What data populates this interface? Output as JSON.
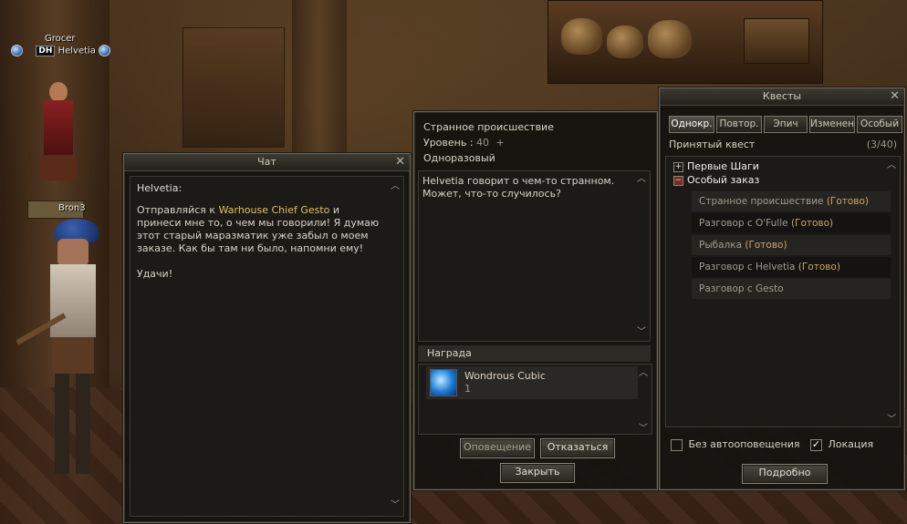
{
  "nameplates": {
    "grocer": "Grocer",
    "player_clan": "DH",
    "player_name": "Helvetia",
    "npc_bron": "Bron3"
  },
  "chat": {
    "title": "Чат",
    "speaker": "Helvetia:",
    "line1_pre": "Отправляйся к ",
    "line1_npc": "Warhouse Chief Gesto",
    "line1_post": " и принеси мне то, о чем мы говорили! Я думаю этот старый маразматик уже забыл о моем заказе. Как бы там ни было, напомни ему!",
    "line2": "Удачи!"
  },
  "quest_detail": {
    "name": "Странное происшествие",
    "level_label": "Уровень :",
    "level_value": "40",
    "level_plus": "+",
    "type": "Одноразовый",
    "description": "Helvetia говорит о чем-то странном. Может, что-то случилось?",
    "reward_header": "Награда",
    "reward_item": "Wondrous Cubic",
    "reward_qty": "1",
    "btn_notify": "Оповещение",
    "btn_decline": "Отказаться",
    "btn_close": "Закрыть"
  },
  "quests": {
    "title": "Квесты",
    "tabs": [
      "Однокр.",
      "Повтор.",
      "Эпич",
      "Изменен",
      "Особый"
    ],
    "accepted_label": "Принятый квест",
    "accepted_count": "(3/40)",
    "groups": [
      "Первые Шаги",
      "Особый заказ"
    ],
    "items": [
      {
        "name": "Странное происшествие",
        "status": "(Готово)"
      },
      {
        "name": "Разговор с O'Fulle",
        "status": "(Готово)"
      },
      {
        "name": "Рыбалка",
        "status": "(Готово)"
      },
      {
        "name": "Разговор с Helvetia",
        "status": "(Готово)"
      },
      {
        "name": "Разговор с Gesto",
        "status": ""
      }
    ],
    "opt_no_notify": "Без автооповещения",
    "opt_location": "Локация",
    "btn_details": "Подробно"
  },
  "icons": {
    "close": "close-icon",
    "scroll_up": "scroll-up-icon",
    "scroll_down": "scroll-down-icon",
    "reward": "cube-icon"
  },
  "colors": {
    "npc_highlight": "#e0c060",
    "status_done": "#c9a768",
    "level_value": "#9b9788"
  }
}
